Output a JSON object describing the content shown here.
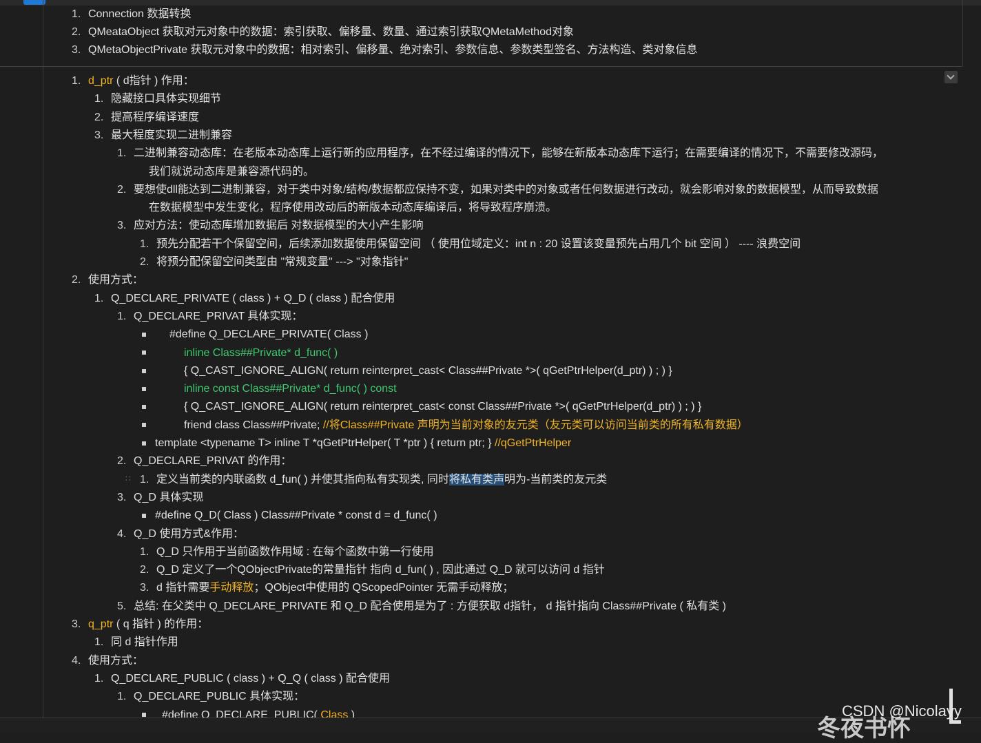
{
  "top_section": {
    "items": [
      {
        "num": "1.",
        "text": "Connection 数据转换"
      },
      {
        "num": "2.",
        "text": "QMeataObject 获取对元对象中的数据：索引获取、偏移量、数量、通过索引获取QMetaMethod对象"
      },
      {
        "num": "3.",
        "text": "QMetaObjectPrivate 获取元对象中的数据：相对索引、偏移量、绝对索引、参数信息、参数类型签名、方法构造、类对象信息"
      }
    ]
  },
  "outline": [
    {
      "id": "l1",
      "num": "1.",
      "parts": [
        {
          "t": "d_ptr",
          "c": "y"
        },
        {
          "t": " ( d指针 ) 作用：",
          "c": ""
        }
      ]
    },
    {
      "id": "l2",
      "num": "1.",
      "parts": [
        {
          "t": "隐藏接口具体实现细节",
          "c": ""
        }
      ]
    },
    {
      "id": "l3",
      "num": "2.",
      "parts": [
        {
          "t": "提高程序编译速度",
          "c": ""
        }
      ]
    },
    {
      "id": "l4",
      "num": "3.",
      "parts": [
        {
          "t": "最大程度实现二进制兼容",
          "c": ""
        }
      ]
    },
    {
      "id": "l5",
      "num": "1.",
      "parts": [
        {
          "t": "二进制兼容动态库：在老版本动态库上运行新的应用程序，在不经过编译的情况下，能够在新版本动态库下运行；在需要编译的情况下，不需要修改源码，",
          "c": ""
        }
      ]
    },
    {
      "id": "l6",
      "num": "",
      "parts": [
        {
          "t": "我们就说动态库是兼容源代码的。",
          "c": ""
        }
      ]
    },
    {
      "id": "l7",
      "num": "2.",
      "parts": [
        {
          "t": "要想使dll能达到二进制兼容，对于类中对象/结构/数据都应保持不变，如果对类中的对象或者任何数据进行改动，就会影响对象的数据模型，从而导致数据",
          "c": ""
        }
      ]
    },
    {
      "id": "l8",
      "num": "",
      "parts": [
        {
          "t": "在数据模型中发生变化，程序使用改动后的新版本动态库编译后，将导致程序崩溃。",
          "c": ""
        }
      ]
    },
    {
      "id": "l9",
      "num": "3.",
      "parts": [
        {
          "t": "应对方法：使动态库增加数据后 对数据模型的大小产生影响",
          "c": ""
        }
      ]
    },
    {
      "id": "l10",
      "num": "1.",
      "parts": [
        {
          "t": "预先分配若干个保留空间，后续添加数据使用保留空间 （ 使用位域定义：int n : 20  设置该变量预先占用几个 bit 空间 ） ---- 浪费空间",
          "c": ""
        }
      ]
    },
    {
      "id": "l11",
      "num": "2.",
      "parts": [
        {
          "t": "将预分配保留空间类型由 \"常规变量\" ---> \"对象指针\"",
          "c": ""
        }
      ]
    },
    {
      "id": "l12",
      "num": "2.",
      "parts": [
        {
          "t": "使用方式：",
          "c": ""
        }
      ]
    },
    {
      "id": "l13",
      "num": "1.",
      "parts": [
        {
          "t": "Q_DECLARE_PRIVATE ( class ) + Q_D ( class ) 配合使用",
          "c": ""
        }
      ]
    },
    {
      "id": "l14",
      "num": "1.",
      "parts": [
        {
          "t": "Q_DECLARE_PRIVAT 具体实现：",
          "c": ""
        }
      ]
    },
    {
      "id": "l15",
      "num": "■",
      "parts": [
        {
          "t": "#define Q_DECLARE_PRIVATE( Class )",
          "c": ""
        }
      ]
    },
    {
      "id": "l16",
      "num": "■",
      "parts": [
        {
          "t": "inline Class##Private* d_func( )",
          "c": "g"
        }
      ]
    },
    {
      "id": "l17",
      "num": "■",
      "parts": [
        {
          "t": "{ Q_CAST_IGNORE_ALIGN( return reinterpret_cast< Class##Private *>( qGetPtrHelper(d_ptr) ) ; ) }",
          "c": ""
        }
      ]
    },
    {
      "id": "l18",
      "num": "■",
      "parts": [
        {
          "t": "inline const Class##Private* d_func( ) const",
          "c": "g"
        }
      ]
    },
    {
      "id": "l19",
      "num": "■",
      "parts": [
        {
          "t": "{ Q_CAST_IGNORE_ALIGN( return reinterpret_cast< const Class##Private *>( qGetPtrHelper(d_ptr) ) ; ) }",
          "c": ""
        }
      ]
    },
    {
      "id": "l20",
      "num": "■",
      "parts": [
        {
          "t": "friend class Class##Private;  ",
          "c": ""
        },
        {
          "t": "//将Class##Private 声明为当前对象的友元类（友元类可以访问当前类的所有私有数据）",
          "c": "y"
        }
      ]
    },
    {
      "id": "l21",
      "num": "■",
      "parts": [
        {
          "t": "template <typename T> inline T *qGetPtrHelper( T *ptr ) { return ptr; }  ",
          "c": ""
        },
        {
          "t": "//qGetPtrHelper",
          "c": "y"
        }
      ]
    },
    {
      "id": "l22",
      "num": "2.",
      "parts": [
        {
          "t": "Q_DECLARE_PRIVAT 的作用：",
          "c": ""
        }
      ]
    },
    {
      "id": "l23",
      "num": "1.",
      "parts": [
        {
          "t": "定义当前类的内联函数 d_fun( ) 并使其指向私有实现类, 同时",
          "c": ""
        },
        {
          "t": "将私有类声",
          "c": "hl"
        },
        {
          "t": "明为-当前类的友元类",
          "c": ""
        }
      ]
    },
    {
      "id": "l24",
      "num": "3.",
      "parts": [
        {
          "t": "Q_D 具体实现",
          "c": ""
        }
      ]
    },
    {
      "id": "l25",
      "num": "■",
      "parts": [
        {
          "t": "#define Q_D( Class ) Class##Private * const d = d_func( )",
          "c": ""
        }
      ]
    },
    {
      "id": "l26",
      "num": "4.",
      "parts": [
        {
          "t": "Q_D 使用方式&作用：",
          "c": ""
        }
      ]
    },
    {
      "id": "l27",
      "num": "1.",
      "parts": [
        {
          "t": "Q_D 只作用于当前函数作用域 : 在每个函数中第一行使用",
          "c": ""
        }
      ]
    },
    {
      "id": "l28",
      "num": "2.",
      "parts": [
        {
          "t": "Q_D 定义了一个QObjectPrivate的常量指针 指向 d_fun( ) , 因此通过 Q_D 就可以访问 d 指针",
          "c": ""
        }
      ]
    },
    {
      "id": "l29",
      "num": "3.",
      "parts": [
        {
          "t": "d 指针需要",
          "c": ""
        },
        {
          "t": "手动释放",
          "c": "y"
        },
        {
          "t": "；QObject中使用的 QScopedPointer 无需手动释放；",
          "c": ""
        }
      ]
    },
    {
      "id": "l30",
      "num": "5.",
      "parts": [
        {
          "t": "总结: 在父类中 Q_DECLARE_PRIVATE 和 Q_D 配合使用是为了 : 方便获取 d指针，  d 指针指向 Class##Private ( 私有类 )",
          "c": ""
        }
      ]
    },
    {
      "id": "l31",
      "num": "3.",
      "parts": [
        {
          "t": "q_ptr",
          "c": "y"
        },
        {
          "t": " ( q 指针 ) 的作用：",
          "c": ""
        }
      ]
    },
    {
      "id": "l32",
      "num": "1.",
      "parts": [
        {
          "t": "同 d 指针作用",
          "c": ""
        }
      ]
    },
    {
      "id": "l33",
      "num": "4.",
      "parts": [
        {
          "t": "使用方式：",
          "c": ""
        }
      ]
    },
    {
      "id": "l34",
      "num": "1.",
      "parts": [
        {
          "t": "Q_DECLARE_PUBLIC ( class ) + Q_Q ( class ) 配合使用",
          "c": ""
        }
      ]
    },
    {
      "id": "l35",
      "num": "1.",
      "parts": [
        {
          "t": "Q_DECLARE_PUBLIC 具体实现：",
          "c": ""
        }
      ]
    },
    {
      "id": "l36",
      "num": "■",
      "parts": [
        {
          "t": "#define Q_DECLARE_PUBLIC( ",
          "c": ""
        },
        {
          "t": "Class",
          "c": "y"
        },
        {
          "t": " )",
          "c": ""
        }
      ]
    }
  ],
  "watermark": {
    "line1": "CSDN @Nicolayy",
    "line2": "冬夜书怀"
  }
}
